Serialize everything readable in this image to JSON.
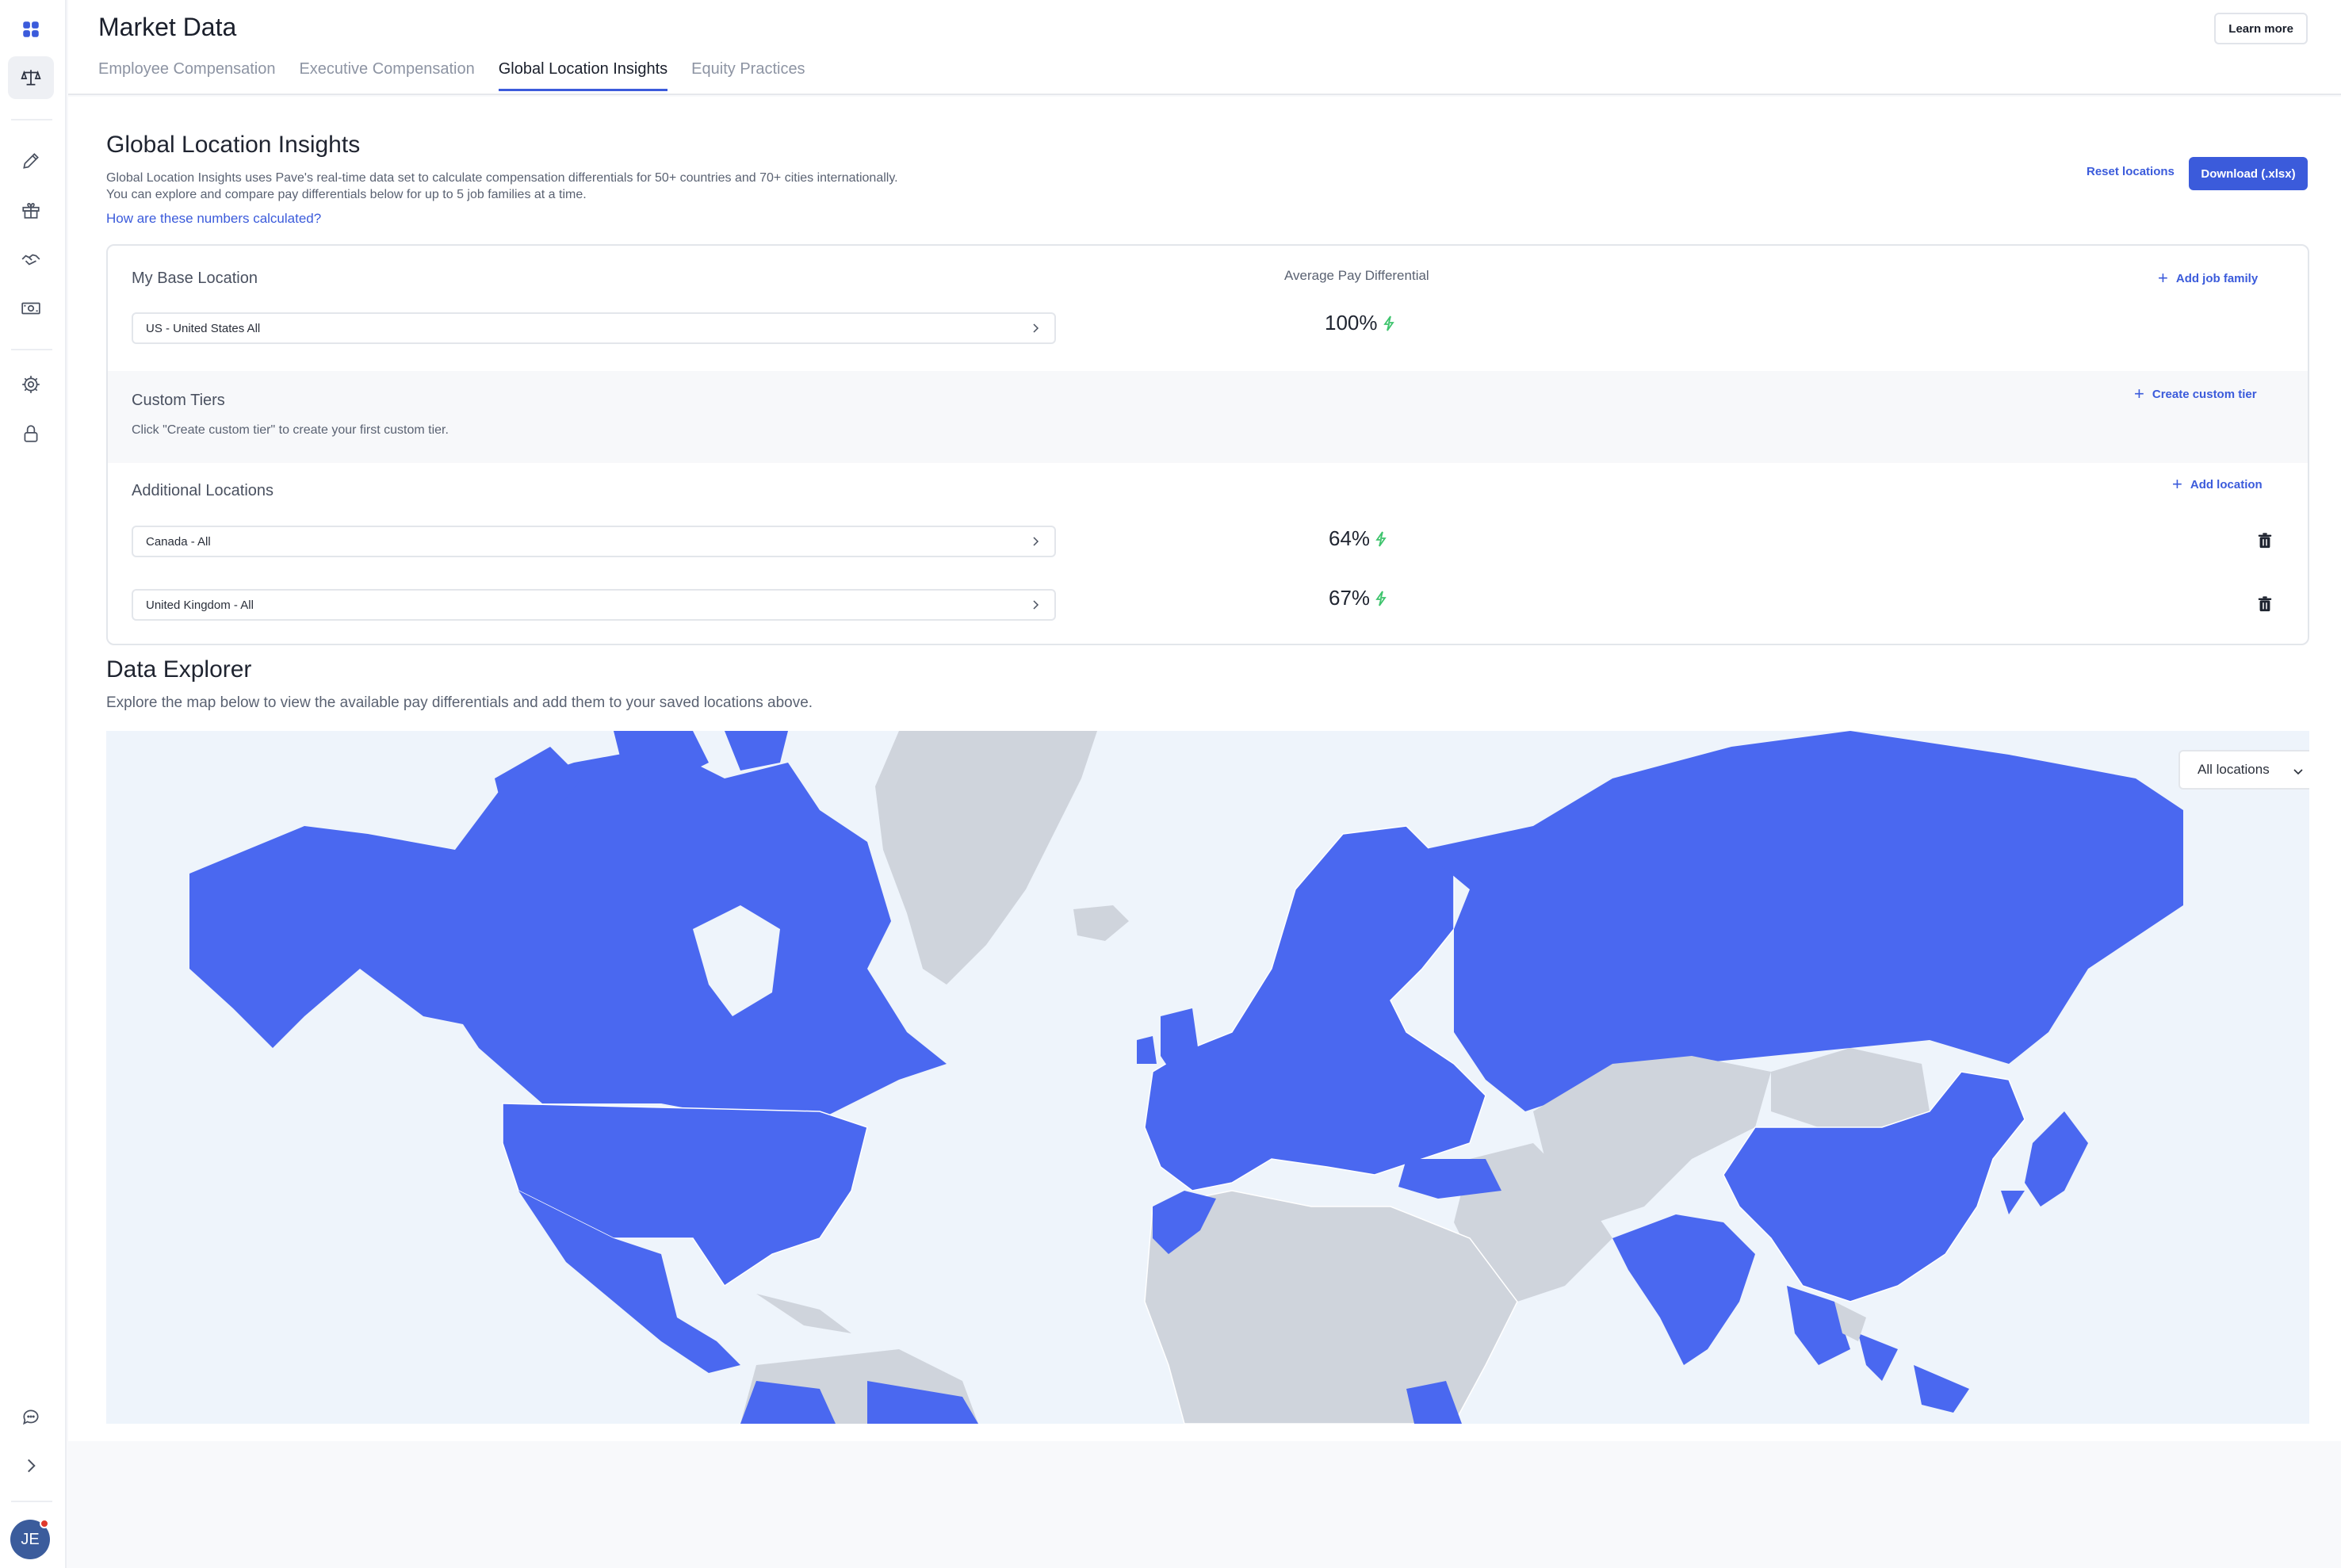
{
  "app": {
    "title": "Market Data",
    "learn_more": "Learn more",
    "user_initials": "JE"
  },
  "tabs": [
    {
      "label": "Employee Compensation",
      "active": false
    },
    {
      "label": "Executive Compensation",
      "active": false
    },
    {
      "label": "Global Location Insights",
      "active": true
    },
    {
      "label": "Equity Practices",
      "active": false
    }
  ],
  "sidebar": {
    "icons": [
      "apps-icon",
      "scale-icon",
      "pencil-icon",
      "gift-icon",
      "handshake-icon",
      "money-icon",
      "gear-icon",
      "lock-icon",
      "chat-icon",
      "chevron-right-icon"
    ]
  },
  "main": {
    "title": "Global Location Insights",
    "description_1": "Global Location Insights uses Pave's real-time data set to calculate compensation differentials for 50+ countries and 70+ cities internationally.",
    "description_2": "You can explore and compare pay differentials below for up to 5 job families at a time.",
    "how_link": "How are these numbers calculated?",
    "reset_label": "Reset locations",
    "download_label": "Download (.xlsx)"
  },
  "base": {
    "label": "My Base Location",
    "avg_label": "Average Pay Differential",
    "add_job_family": "Add job family",
    "location": "US - United States All",
    "differential": "100%"
  },
  "tiers": {
    "label": "Custom Tiers",
    "hint": "Click \"Create custom tier\" to create your first custom tier.",
    "create_label": "Create custom tier"
  },
  "additional": {
    "label": "Additional Locations",
    "add_label": "Add location",
    "locations": [
      {
        "name": "Canada - All",
        "differential": "64%"
      },
      {
        "name": "United Kingdom - All",
        "differential": "67%"
      }
    ]
  },
  "explorer": {
    "title": "Data Explorer",
    "description": "Explore the map below to view the available pay differentials and add them to your saved locations above.",
    "filter_label": "All locations"
  },
  "colors": {
    "accent": "#3b5bdb",
    "map_highlight": "#4a68f0",
    "map_inactive": "#cfd4dc",
    "map_water": "#eef4fb",
    "bolt": "#3ec46d"
  }
}
